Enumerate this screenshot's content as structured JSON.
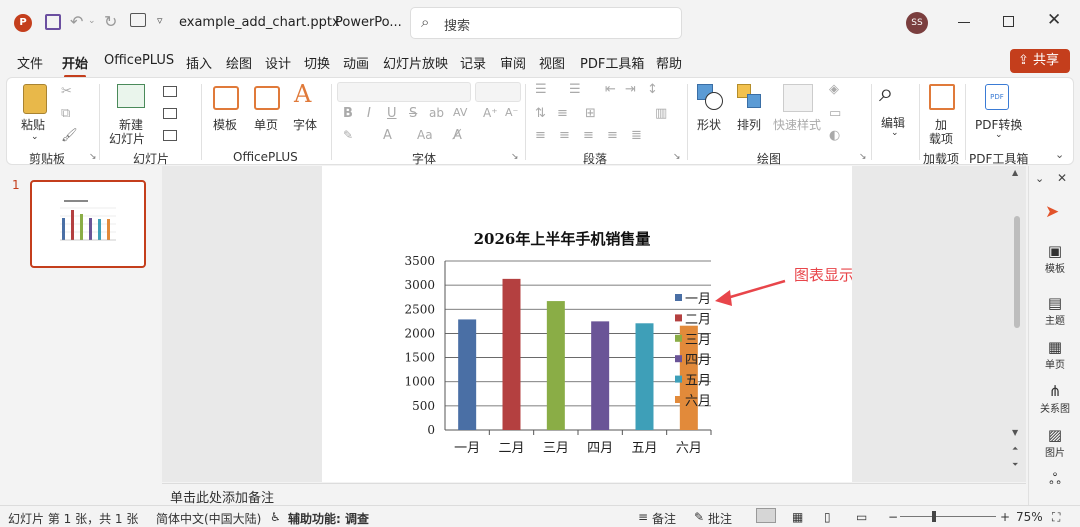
{
  "titlebar": {
    "filename": "example_add_chart.pptx",
    "app": "PowerPo...",
    "search_placeholder": "搜索",
    "avatar_initials": "SS"
  },
  "menu": {
    "tabs": [
      "文件",
      "开始",
      "OfficePLUS",
      "插入",
      "绘图",
      "设计",
      "切换",
      "动画",
      "幻灯片放映",
      "记录",
      "审阅",
      "视图",
      "PDF工具箱",
      "帮助"
    ],
    "share": "共享"
  },
  "ribbon": {
    "paste": "粘贴",
    "new_slide_1": "新建",
    "new_slide_2": "幻灯片",
    "template": "模板",
    "single_page": "单页",
    "font_btn": "字体",
    "shape": "形状",
    "arrange": "排列",
    "quick_style": "快速样式",
    "edit": "编辑",
    "addin_1": "加",
    "addin_2": "载项",
    "pdf_convert": "PDF转换",
    "groups": {
      "clipboard": "剪贴板",
      "slides": "幻灯片",
      "officeplus": "OfficePLUS",
      "font": "字体",
      "paragraph": "段落",
      "drawing": "绘图",
      "addins": "加载项",
      "pdf": "PDF工具箱"
    }
  },
  "thumbs": {
    "slide_number": "1"
  },
  "annotation": {
    "text": "图表显示图例",
    "color": "#e8454a"
  },
  "chart_data": {
    "type": "bar",
    "title": "2026年上半年手机销售量",
    "categories": [
      "一月",
      "二月",
      "三月",
      "四月",
      "五月",
      "六月"
    ],
    "values": [
      2290,
      3130,
      2670,
      2250,
      2210,
      2160
    ],
    "colors": [
      "#4a6fa5",
      "#b44040",
      "#8aad46",
      "#6a5497",
      "#3e9fb8",
      "#e28a3a"
    ],
    "ylim": [
      0,
      3500
    ],
    "yticks": [
      0,
      500,
      1000,
      1500,
      2000,
      2500,
      3000,
      3500
    ],
    "grid": true,
    "legend": "right",
    "legend_entries": [
      "一月",
      "二月",
      "三月",
      "四月",
      "五月",
      "六月"
    ]
  },
  "notes": {
    "placeholder": "单击此处添加备注"
  },
  "rightpane": {
    "items": [
      "模板",
      "主题",
      "单页",
      "关系图",
      "图片"
    ]
  },
  "status": {
    "slide_info": "幻灯片 第 1 张，共 1 张",
    "language": "简体中文(中国大陆)",
    "accessibility": "辅助功能: 调查",
    "notes": "备注",
    "comments": "批注",
    "zoom": "75%"
  }
}
